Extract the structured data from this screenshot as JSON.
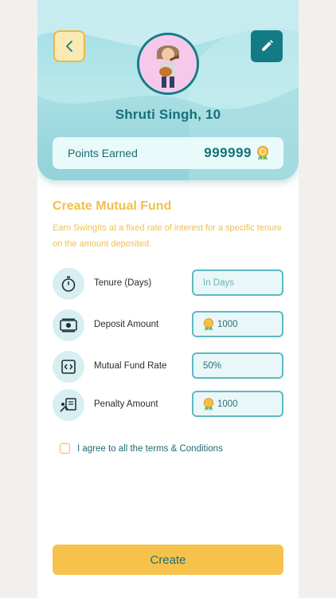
{
  "header": {
    "user_name": "Shruti Singh, 10",
    "points_label": "Points Earned",
    "points_value": "999999"
  },
  "section": {
    "title": "Create Mutual Fund",
    "description": "Earn SwingIts at a fixed rate of interest for a specific tenure on the amount deposited."
  },
  "fields": [
    {
      "label": "Tenure (Days)",
      "value": "",
      "placeholder": "In Days",
      "icon": "stopwatch-icon"
    },
    {
      "label": "Deposit Amount",
      "value": "1000",
      "icon": "cash-icon"
    },
    {
      "label": "Mutual Fund Rate",
      "value": "50%",
      "icon": "code-file-icon"
    },
    {
      "label": "Penalty Amount",
      "value": "1000",
      "icon": "penalty-icon"
    }
  ],
  "agree": {
    "label": "I agree to all the terms & Conditions",
    "checked": false
  },
  "actions": {
    "create_label": "Create"
  },
  "colors": {
    "teal": "#137b86",
    "accent_yellow": "#f6c24c",
    "header_bg": "#a8e1e6",
    "input_border": "#5db9c2"
  }
}
